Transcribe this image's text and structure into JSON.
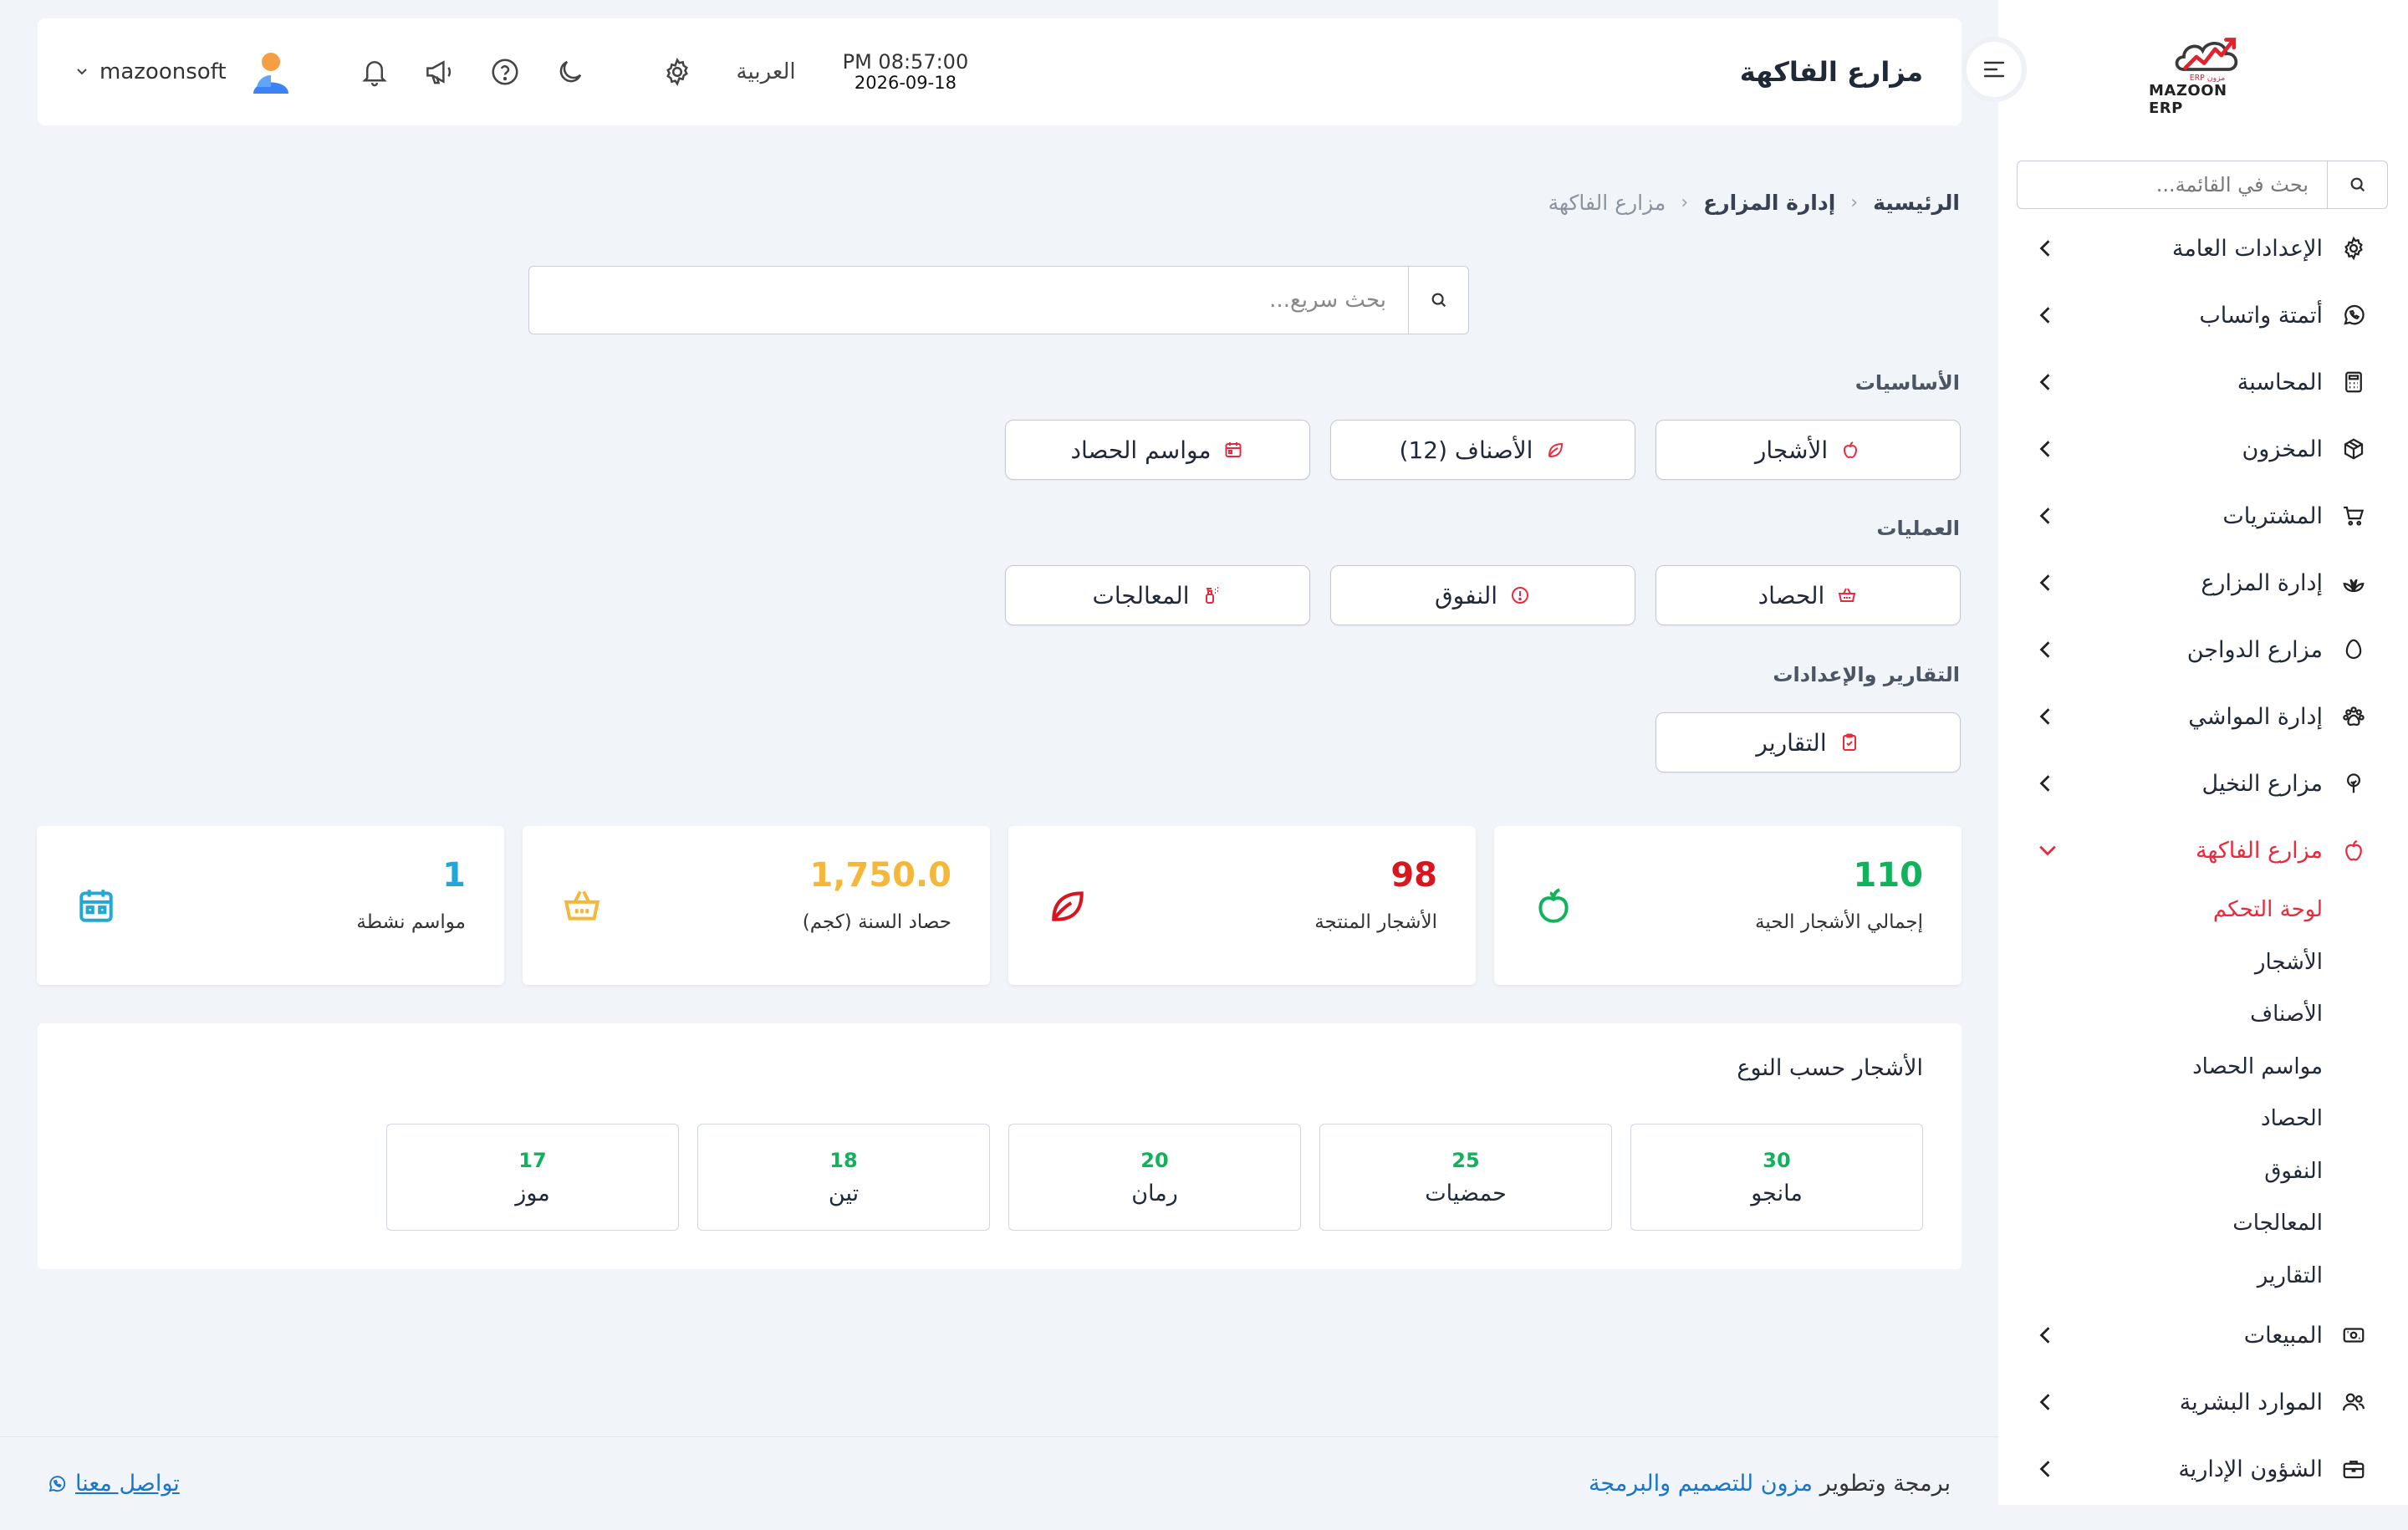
{
  "app": {
    "logo_text": "MAZOON ERP",
    "logo_arabic": "مزون ERP"
  },
  "sidebar": {
    "search_placeholder": "بحث في القائمة...",
    "items": [
      {
        "label": "الإعدادات العامة",
        "icon": "gear-icon"
      },
      {
        "label": "أتمتة واتساب",
        "icon": "whatsapp-icon"
      },
      {
        "label": "المحاسبة",
        "icon": "calculator-icon"
      },
      {
        "label": "المخزون",
        "icon": "box-icon"
      },
      {
        "label": "المشتريات",
        "icon": "cart-icon"
      },
      {
        "label": "إدارة المزارع",
        "icon": "plant-icon"
      },
      {
        "label": "مزارع الدواجن",
        "icon": "egg-icon"
      },
      {
        "label": "إدارة المواشي",
        "icon": "paw-icon"
      },
      {
        "label": "مزارع النخيل",
        "icon": "tree-icon"
      },
      {
        "label": "مزارع الفاكهة",
        "icon": "apple-icon",
        "active": true
      },
      {
        "label": "المبيعات",
        "icon": "cash-icon"
      },
      {
        "label": "الموارد البشرية",
        "icon": "users-icon"
      },
      {
        "label": "الشؤون الإدارية",
        "icon": "briefcase-icon"
      }
    ],
    "submenu": [
      {
        "label": "لوحة التحكم",
        "active": true
      },
      {
        "label": "الأشجار"
      },
      {
        "label": "الأصناف"
      },
      {
        "label": "مواسم الحصاد"
      },
      {
        "label": "الحصاد"
      },
      {
        "label": "النفوق"
      },
      {
        "label": "المعالجات"
      },
      {
        "label": "التقارير"
      }
    ]
  },
  "header": {
    "title": "مزارع الفاكهة",
    "time": "PM 08:57:00",
    "date": "2026-09-18",
    "language": "العربية",
    "username": "mazoonsoft"
  },
  "breadcrumb": {
    "home": "الرئيسية",
    "parent": "إدارة المزارع",
    "current": "مزارع الفاكهة"
  },
  "quick_search": {
    "placeholder": "بحث سريع..."
  },
  "sections": {
    "basics": {
      "title": "الأساسيات",
      "buttons": [
        "الأشجار",
        "الأصناف (12)",
        "مواسم الحصاد"
      ]
    },
    "operations": {
      "title": "العمليات",
      "buttons": [
        "الحصاد",
        "النفوق",
        "المعالجات"
      ]
    },
    "reports": {
      "title": "التقارير والإعدادات",
      "buttons": [
        "التقارير"
      ]
    }
  },
  "stats": [
    {
      "value": "110",
      "label": "إجمالي الأشجار الحية",
      "color": "#10b25c",
      "icon": "apple-icon"
    },
    {
      "value": "98",
      "label": "الأشجار المنتجة",
      "color": "#d9161f",
      "icon": "leaf-icon"
    },
    {
      "value": "1,750.0",
      "label": "حصاد السنة (كجم)",
      "color": "#f4b73a",
      "icon": "basket-icon"
    },
    {
      "value": "1",
      "label": "مواسم نشطة",
      "color": "#22a7d9",
      "icon": "calendar-icon"
    }
  ],
  "tree_types": {
    "title": "الأشجار حسب النوع",
    "items": [
      {
        "count": "30",
        "name": "مانجو"
      },
      {
        "count": "25",
        "name": "حمضيات"
      },
      {
        "count": "20",
        "name": "رمان"
      },
      {
        "count": "18",
        "name": "تين"
      },
      {
        "count": "17",
        "name": "موز"
      }
    ]
  },
  "footer": {
    "credit_prefix": "برمجة وتطوير",
    "credit_link": "مزون للتصميم والبرمجة",
    "contact": "تواصل معنا"
  },
  "colors": {
    "accent": "#ea2a3c",
    "link": "#1b75c9",
    "green": "#10b25c"
  }
}
